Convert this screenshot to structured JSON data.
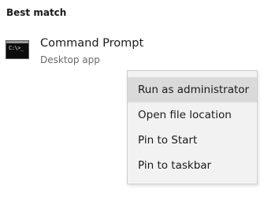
{
  "section": {
    "title": "Best match"
  },
  "result": {
    "icon": "command-prompt-icon",
    "icon_text": "C:\\>_",
    "name": "Command Prompt",
    "type": "Desktop app"
  },
  "context_menu": {
    "highlighted_index": 0,
    "items": [
      {
        "label": "Run as administrator"
      },
      {
        "label": "Open file location"
      },
      {
        "label": "Pin to Start"
      },
      {
        "label": "Pin to taskbar"
      }
    ]
  },
  "colors": {
    "menu_background": "#f2f2f2",
    "menu_highlight": "#dadada",
    "icon_background": "#0c0c0c"
  }
}
